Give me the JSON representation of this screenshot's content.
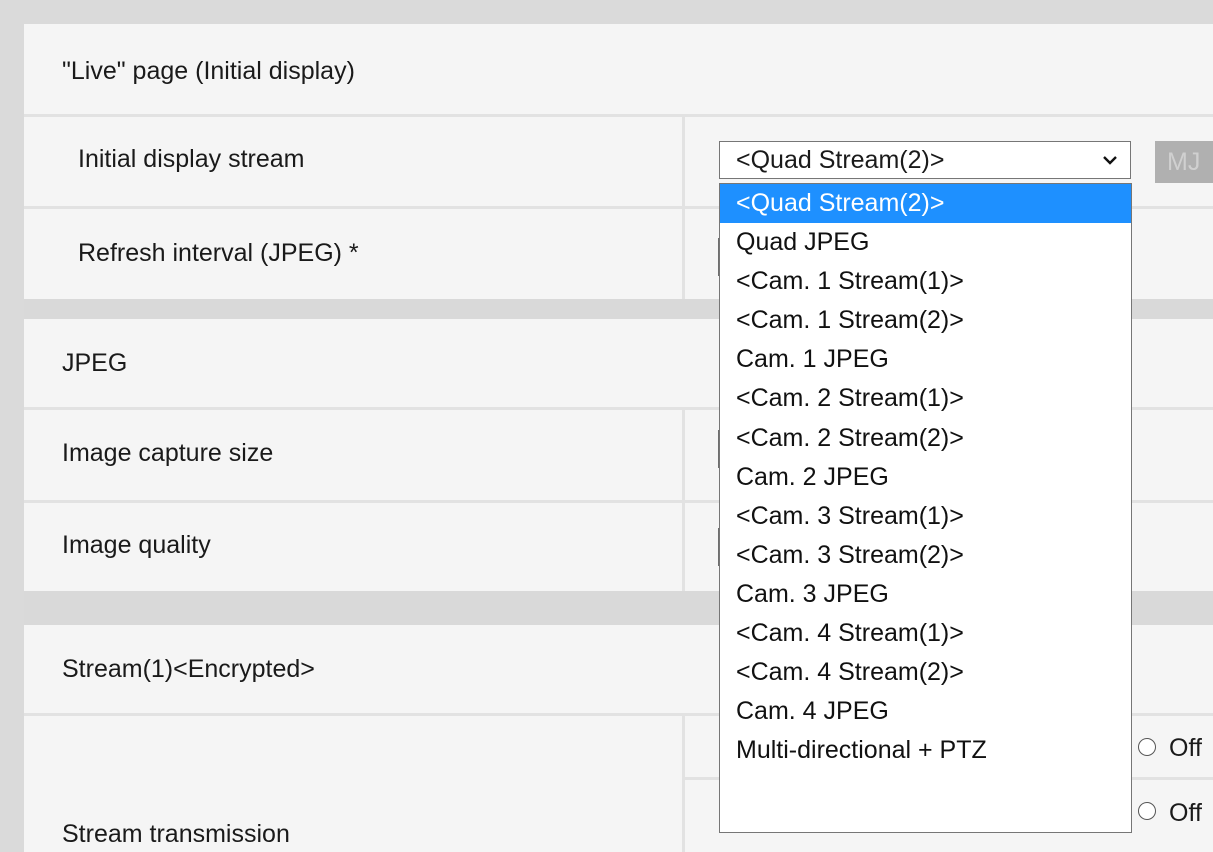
{
  "live_page": {
    "section_title": "\"Live\" page (Initial display)",
    "initial_stream_label": "Initial display stream",
    "refresh_label": "Refresh interval (JPEG) *"
  },
  "jpeg": {
    "section_title": "JPEG",
    "capture_size_label": "Image capture size",
    "quality_label": "Image quality"
  },
  "stream1": {
    "section_title": "Stream(1)<Encrypted>",
    "transmission_label": "Stream transmission",
    "off_label_1": "Off",
    "off_label_2": "Off"
  },
  "select": {
    "value": "<Quad Stream(2)>",
    "options": [
      "<Quad Stream(2)>",
      "Quad JPEG",
      "<Cam. 1 Stream(1)>",
      "<Cam. 1 Stream(2)>",
      "Cam. 1 JPEG",
      "<Cam. 2 Stream(1)>",
      "<Cam. 2 Stream(2)>",
      "Cam. 2 JPEG",
      "<Cam. 3 Stream(1)>",
      "<Cam. 3 Stream(2)>",
      "Cam. 3 JPEG",
      "<Cam. 4 Stream(1)>",
      "<Cam. 4 Stream(2)>",
      "Cam. 4 JPEG",
      "Multi-directional + PTZ"
    ]
  },
  "mj_button": {
    "label": "MJ"
  },
  "colors": {
    "highlight": "#1e90ff",
    "background": "#dadada",
    "panel": "#f5f5f5"
  }
}
